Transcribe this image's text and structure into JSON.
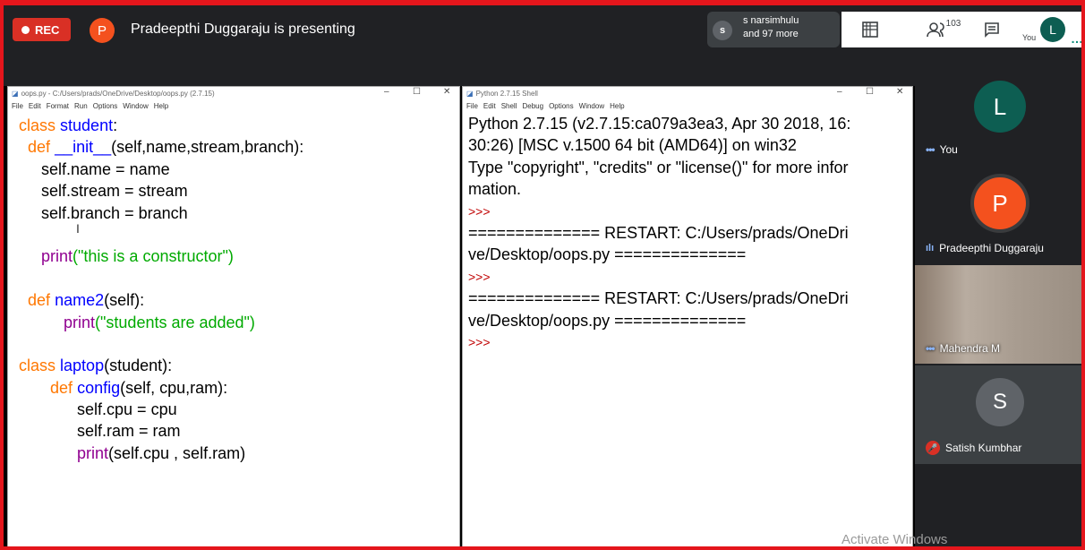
{
  "meeting": {
    "rec_label": "REC",
    "presenter_initial": "P",
    "presenter_text": "Pradeepthi Duggaraju is presenting",
    "viewers_initial": "s",
    "viewers_line1": "s narsimhulu",
    "viewers_line2": "and 97 more",
    "participants_count": "103",
    "you_label": "You",
    "you_initial": "L"
  },
  "editor": {
    "title": "oops.py - C:/Users/prads/OneDrive/Desktop/oops.py (2.7.15)",
    "menu": [
      "File",
      "Edit",
      "Format",
      "Run",
      "Options",
      "Window",
      "Help"
    ],
    "code": {
      "l1_kw": "class",
      "l1_name": "student",
      "l1_rest": ":",
      "l2_kw": "def",
      "l2_name": "__init__",
      "l2_rest": "(self,name,stream,branch):",
      "l3": "self.name = name",
      "l4": "self.stream = stream",
      "l5": "self.branch = branch",
      "l7_bi": "print",
      "l7_str": "(\"this is a constructor\")",
      "l9_kw": "def",
      "l9_name": "name2",
      "l9_rest": "(self):",
      "l10_bi": "print",
      "l10_str": "(\"students are added\")",
      "l12_kw": "class",
      "l12_name": "laptop",
      "l12_rest": "(student):",
      "l13_kw": "def",
      "l13_name": "config",
      "l13_rest": "(self, cpu,ram):",
      "l14": "self.cpu = cpu",
      "l15": "self.ram = ram",
      "l16_bi": "print",
      "l16_rest": "(self.cpu , self.ram)"
    }
  },
  "shell": {
    "title": "Python 2.7.15 Shell",
    "menu": [
      "File",
      "Edit",
      "Shell",
      "Debug",
      "Options",
      "Window",
      "Help"
    ],
    "lines": [
      "Python 2.7.15 (v2.7.15:ca079a3ea3, Apr 30 2018, 16:",
      "30:26) [MSC v.1500 64 bit (AMD64)] on win32",
      "Type \"copyright\", \"credits\" or \"license()\" for more infor",
      "mation.",
      ">>>",
      "============== RESTART: C:/Users/prads/OneDri",
      "ve/Desktop/oops.py ==============",
      ">>>",
      "============== RESTART: C:/Users/prads/OneDri",
      "ve/Desktop/oops.py ==============",
      ">>>"
    ]
  },
  "participants": [
    {
      "initial": "L",
      "name": "You",
      "color": "#0d5e52"
    },
    {
      "initial": "P",
      "name": "Pradeepthi Duggaraju",
      "color": "#f4511e"
    },
    {
      "initial": "",
      "name": "Mahendra M",
      "color": ""
    },
    {
      "initial": "S",
      "name": "Satish Kumbhar",
      "color": "#5f6368"
    }
  ],
  "watermark": "Activate Windows",
  "colors": {
    "rec": "#d93025",
    "accent": "#e4161c"
  }
}
